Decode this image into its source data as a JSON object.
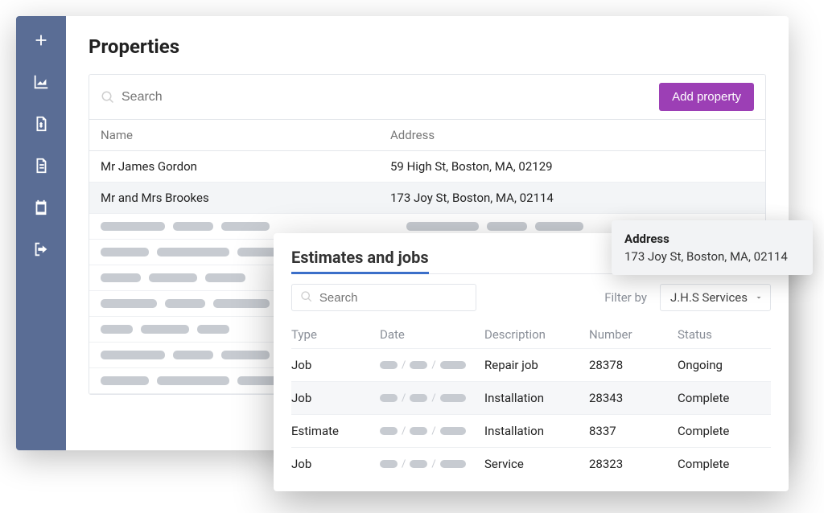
{
  "page": {
    "title": "Properties"
  },
  "search": {
    "placeholder": "Search"
  },
  "buttons": {
    "add_property": "Add property"
  },
  "table": {
    "headers": {
      "name": "Name",
      "address": "Address"
    },
    "rows": [
      {
        "name": "Mr James Gordon",
        "address": "59 High St, Boston, MA, 02129"
      },
      {
        "name": "Mr and Mrs Brookes",
        "address": "173 Joy St, Boston, MA, 02114"
      }
    ]
  },
  "popup": {
    "title": "Estimates and jobs",
    "search_placeholder": "Search",
    "filter_label": "Filter by",
    "filter_value": "J.H.S Services",
    "headers": {
      "type": "Type",
      "date": "Date",
      "description": "Description",
      "number": "Number",
      "status": "Status"
    },
    "rows": [
      {
        "type": "Job",
        "description": "Repair job",
        "number": "28378",
        "status": "Ongoing"
      },
      {
        "type": "Job",
        "description": "Installation",
        "number": "28343",
        "status": "Complete"
      },
      {
        "type": "Estimate",
        "description": "Installation",
        "number": "8337",
        "status": "Complete"
      },
      {
        "type": "Job",
        "description": "Service",
        "number": "28323",
        "status": "Complete"
      }
    ]
  },
  "address_card": {
    "title": "Address",
    "body": "173 Joy St, Boston, MA, 02114"
  }
}
